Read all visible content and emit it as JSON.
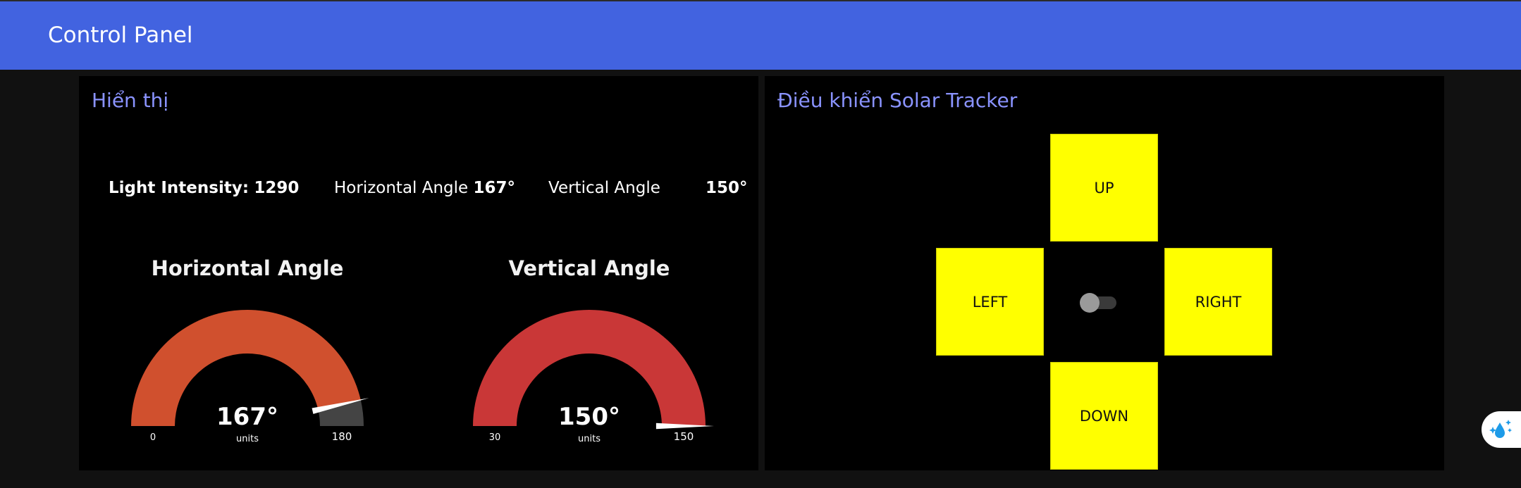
{
  "app": {
    "title": "Control Panel"
  },
  "display": {
    "title": "Hiển thị",
    "light_label": "Light Intensity:",
    "light_value": "1290",
    "horizontal_label": "Horizontal Angle",
    "horizontal_value": "167°",
    "vertical_label": "Vertical Angle",
    "vertical_value": "150°"
  },
  "gauges": [
    {
      "title": "Horizontal Angle",
      "value": 167,
      "value_text": "167°",
      "units": "units",
      "min": 0,
      "max": 180,
      "min_label": "0",
      "max_label": "180",
      "color": "#d0502e",
      "rest_color": "#444444"
    },
    {
      "title": "Vertical Angle",
      "value": 150,
      "value_text": "150°",
      "units": "units",
      "min": 30,
      "max": 150,
      "min_label": "30",
      "max_label": "150",
      "color": "#c93737",
      "rest_color": "#444444"
    }
  ],
  "control": {
    "title": "Điều khiển Solar Tracker",
    "up": "UP",
    "down": "DOWN",
    "left": "LEFT",
    "right": "RIGHT",
    "toggle_on": false
  },
  "colors": {
    "header": "#4263e0",
    "accent_title": "#8a93ff",
    "button": "#ffff00"
  },
  "icons": {
    "fab": "water-sparkle-icon"
  }
}
